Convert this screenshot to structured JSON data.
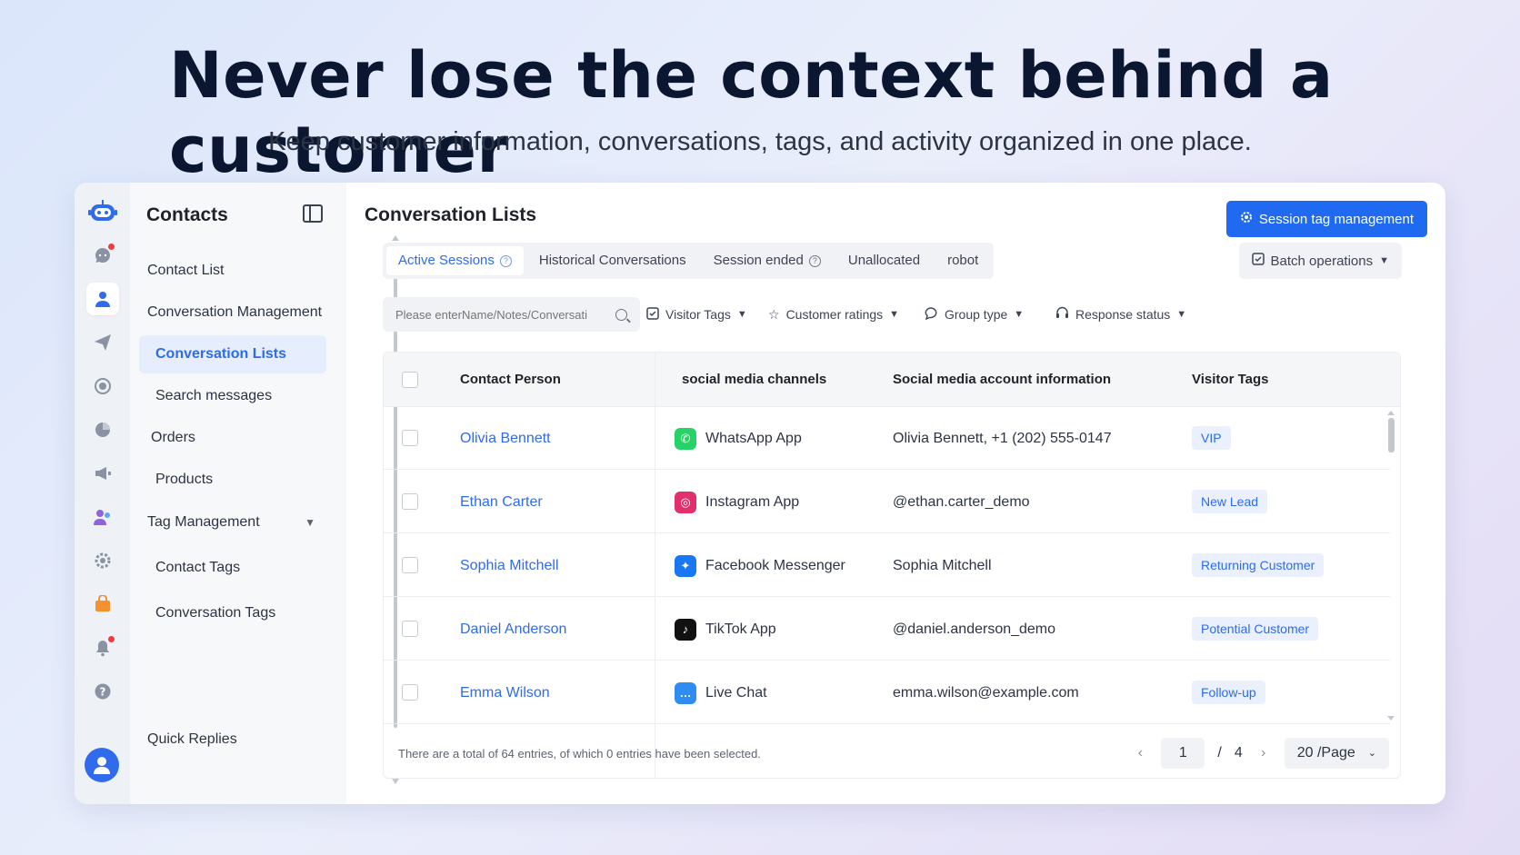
{
  "hero": {
    "headline": "Never lose the context behind a customer",
    "subhead": "Keep customer information, conversations, tags, and activity organized in one place."
  },
  "rail": {
    "icons": [
      "bot-logo-icon",
      "chat-notification-icon",
      "contacts-icon",
      "send-icon",
      "target-icon",
      "pie-chart-icon",
      "megaphone-icon",
      "team-icon",
      "settings-icon",
      "shop-icon",
      "bell-icon",
      "help-icon",
      "user-avatar"
    ]
  },
  "sidebar": {
    "title": "Contacts",
    "items": [
      {
        "label": "Contact List"
      },
      {
        "label": "Conversation Management"
      },
      {
        "label": "Conversation Lists"
      },
      {
        "label": "Search messages"
      },
      {
        "label": "Orders"
      },
      {
        "label": "Products"
      },
      {
        "label": "Tag Management"
      },
      {
        "label": "Contact Tags"
      },
      {
        "label": "Conversation Tags"
      },
      {
        "label": "Quick Replies"
      }
    ]
  },
  "main": {
    "title": "Conversation Lists",
    "primary_button": "Session tag management",
    "batch_button": "Batch operations",
    "tabs": [
      {
        "label": "Active Sessions"
      },
      {
        "label": "Historical Conversations"
      },
      {
        "label": "Session ended"
      },
      {
        "label": "Unallocated"
      },
      {
        "label": "robot"
      }
    ],
    "search": {
      "placeholder": "Please enterName/Notes/Conversati"
    },
    "filters": [
      {
        "label": "Visitor Tags"
      },
      {
        "label": "Customer ratings"
      },
      {
        "label": "Group type"
      },
      {
        "label": "Response status"
      }
    ],
    "table": {
      "columns": [
        "Contact Person",
        "social media channels",
        "Social media account information",
        "Visitor Tags"
      ],
      "rows": [
        {
          "name": "Olivia Bennett",
          "channel": "WhatsApp App",
          "channel_icon": "whatsapp-icon",
          "channel_color": "#25d366",
          "account": "Olivia Bennett, +1 (202) 555-0147",
          "tag": "VIP"
        },
        {
          "name": "Ethan Carter",
          "channel": "Instagram App",
          "channel_icon": "instagram-icon",
          "channel_color": "#e1306c",
          "account": "@ethan.carter_demo",
          "tag": "New Lead"
        },
        {
          "name": "Sophia Mitchell",
          "channel": "Facebook Messenger",
          "channel_icon": "messenger-icon",
          "channel_color": "#1877f2",
          "account": "Sophia Mitchell",
          "tag": "Returning Customer"
        },
        {
          "name": "Daniel Anderson",
          "channel": "TikTok App",
          "channel_icon": "tiktok-icon",
          "channel_color": "#111111",
          "account": "@daniel.anderson_demo",
          "tag": "Potential Customer"
        },
        {
          "name": "Emma Wilson",
          "channel": "Live Chat",
          "channel_icon": "live-chat-icon",
          "channel_color": "#2f8cf0",
          "account": "emma.wilson@example.com",
          "tag": "Follow-up"
        }
      ],
      "footer": "There are a total of 64 entries, of which 0 entries have been selected.",
      "pagination": {
        "current": "1",
        "separator": "/",
        "total": "4",
        "page_size": "20 /Page"
      }
    }
  },
  "colors": {
    "accent": "#1f6af0",
    "tag_bg": "#eaf0fd"
  }
}
